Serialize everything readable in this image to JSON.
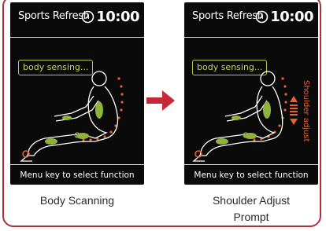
{
  "screens": [
    {
      "title": "Sports Refresh",
      "time": "10:00",
      "badge": "body sensing...",
      "footer": "Menu key to select function",
      "caption": "Body Scanning"
    },
    {
      "title": "Sports Refresh",
      "time": "10:00",
      "badge": "body sensing...",
      "footer": "Menu key to select function",
      "side_label": "Shoulder adjust",
      "caption_line1": "Shoulder Adjust",
      "caption_line2": "Prompt"
    }
  ],
  "colors": {
    "frame": "#b0303a",
    "arrow": "#c8283a",
    "highlight_green": "#8fb23a",
    "dots_orange": "#e8622c",
    "badge_border": "#b8c84a"
  },
  "icons": [
    "clock-icon",
    "right-arrow-icon",
    "up-down-arrow-icon",
    "body-silhouette-icon"
  ]
}
